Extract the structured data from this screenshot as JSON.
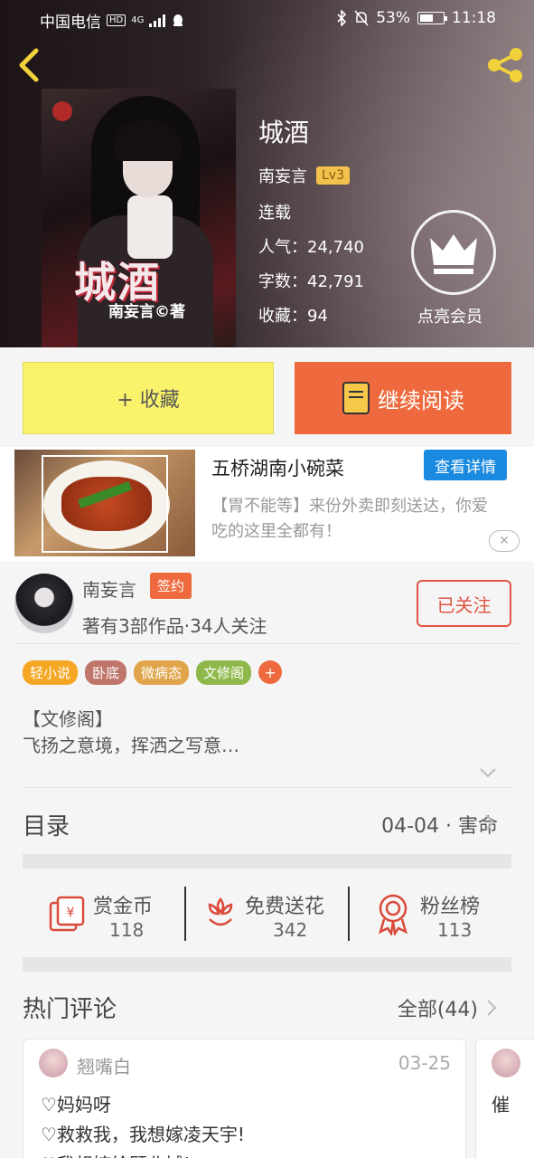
{
  "status_bar": {
    "carrier": "中国电信",
    "network": "4G",
    "battery": "53%",
    "time": "11:18"
  },
  "book": {
    "title": "城酒",
    "author": "南妄言",
    "level": "Lv3",
    "status": "连载",
    "popularity": "人气：24,740",
    "word_count": "字数：42,791",
    "favorites": "收藏：94",
    "cover_title": "城酒",
    "cover_author": "南妄言©著"
  },
  "vip": {
    "label": "点亮会员"
  },
  "actions": {
    "collect": "+ 收藏",
    "continue_read": "继续阅读"
  },
  "ad": {
    "title": "五桥湖南小碗菜",
    "detail_button": "查看详情",
    "desc": "【胃不能等】来份外卖即刻送达，你爱吃的这里全都有！"
  },
  "author_section": {
    "name": "南妄言",
    "sign_tag": "签约",
    "works": "著有3部作品·34人关注",
    "follow_button": "已关注"
  },
  "tags": [
    {
      "label": "轻小说",
      "color": "#f5a623"
    },
    {
      "label": "卧底",
      "color": "#c0766a"
    },
    {
      "label": "微病态",
      "color": "#e0a44a"
    },
    {
      "label": "文修阁",
      "color": "#8fb84a"
    }
  ],
  "intro": {
    "line1": "【文修阁】",
    "line2": "飞扬之意境，挥洒之写意…"
  },
  "toc": {
    "title": "目录",
    "latest": "04-04 · 害命"
  },
  "stats": [
    {
      "label": "赏金币",
      "value": "118",
      "icon": "reward-coin-icon"
    },
    {
      "label": "免费送花",
      "value": "342",
      "icon": "flower-icon"
    },
    {
      "label": "粉丝榜",
      "value": "113",
      "icon": "medal-icon"
    }
  ],
  "hot_comments": {
    "title": "热门评论",
    "all_label": "全部(44)",
    "items": [
      {
        "user": "翘嘴白",
        "date": "03-25",
        "lines": [
          "♡妈妈呀",
          "♡救救我，我想嫁凌天宇!",
          "♡我想嫁给顾北城!"
        ]
      },
      {
        "user": "",
        "date": "",
        "lines": [
          "催"
        ]
      }
    ]
  },
  "colors": {
    "accent": "#ee6a3e",
    "collect_bg": "#faf26a",
    "detail_blue": "#1a8ae0",
    "follow_red": "#e05544"
  }
}
